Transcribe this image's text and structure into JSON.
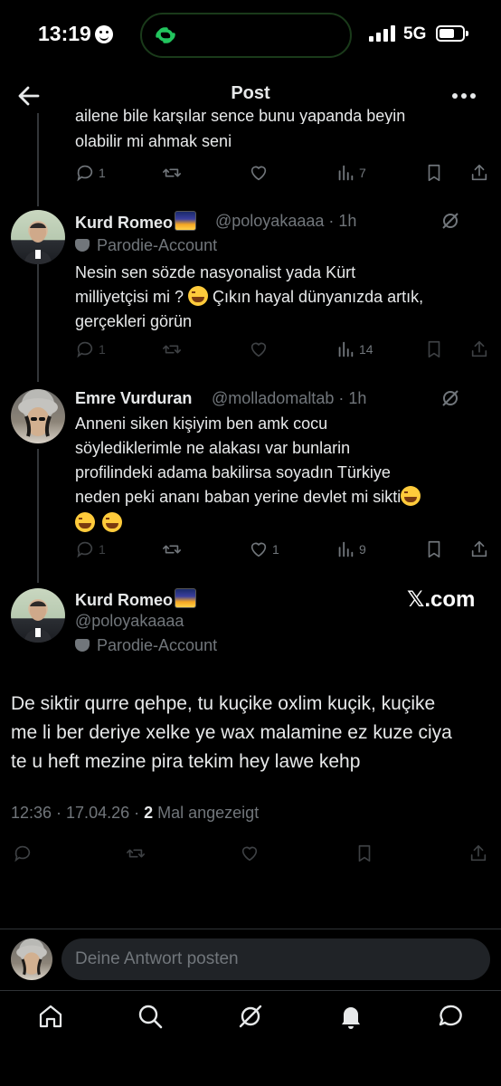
{
  "status_bar": {
    "time": "13:19",
    "network": "5G"
  },
  "header": {
    "title": "Post"
  },
  "tweets": [
    {
      "text_partial_top": "ailene bile karşılar sence bunu yapanda beyin",
      "text": "olabilir mi ahmak seni",
      "replies": "1",
      "retweets": "",
      "likes": "",
      "views": "7"
    },
    {
      "name": "Kurd Romeo",
      "handle": "@poloyakaaaa · 1h",
      "parody": "Parodie-Account",
      "lines": [
        "Nesin sen sözde nasyonalist yada Kürt",
        "milliyetçisi mi ? ",
        " Çıkın hayal dünyanızda artık,",
        "gerçekleri görün"
      ],
      "replies": "1",
      "views": "14"
    },
    {
      "name": "Emre Vurduran",
      "handle": "@molladomaltab · 1h",
      "lines": [
        "Anneni siken kişiyim ben amk cocu",
        "söylediklerimle ne alakası var bunlarin",
        "profilindeki adama bakilirsa soyadın Türkiye",
        "neden peki ananı baban yerine devlet mi sikti"
      ],
      "replies": "1",
      "likes": "1",
      "views": "9"
    }
  ],
  "main_post": {
    "name": "Kurd Romeo",
    "handle": "@poloyakaaaa",
    "parody": "Parodie-Account",
    "watermark": "𝕏.com",
    "lines": [
      "De siktir qurre qehpe, tu kuçike oxlim kuçik, kuçike",
      "me li ber deriye xelke ye wax malamine ez kuze ciya",
      "te u heft mezine pira tekim hey lawe kehp"
    ],
    "time_date": "12:36 · 17.04.26 · ",
    "views_count": "2",
    "views_label": " Mal angezeigt"
  },
  "reply_box": {
    "placeholder": "Deine Antwort posten"
  },
  "colors": {
    "background": "#000000",
    "text": "#e7e9ea",
    "muted": "#71767b",
    "divider": "#2f3336"
  }
}
